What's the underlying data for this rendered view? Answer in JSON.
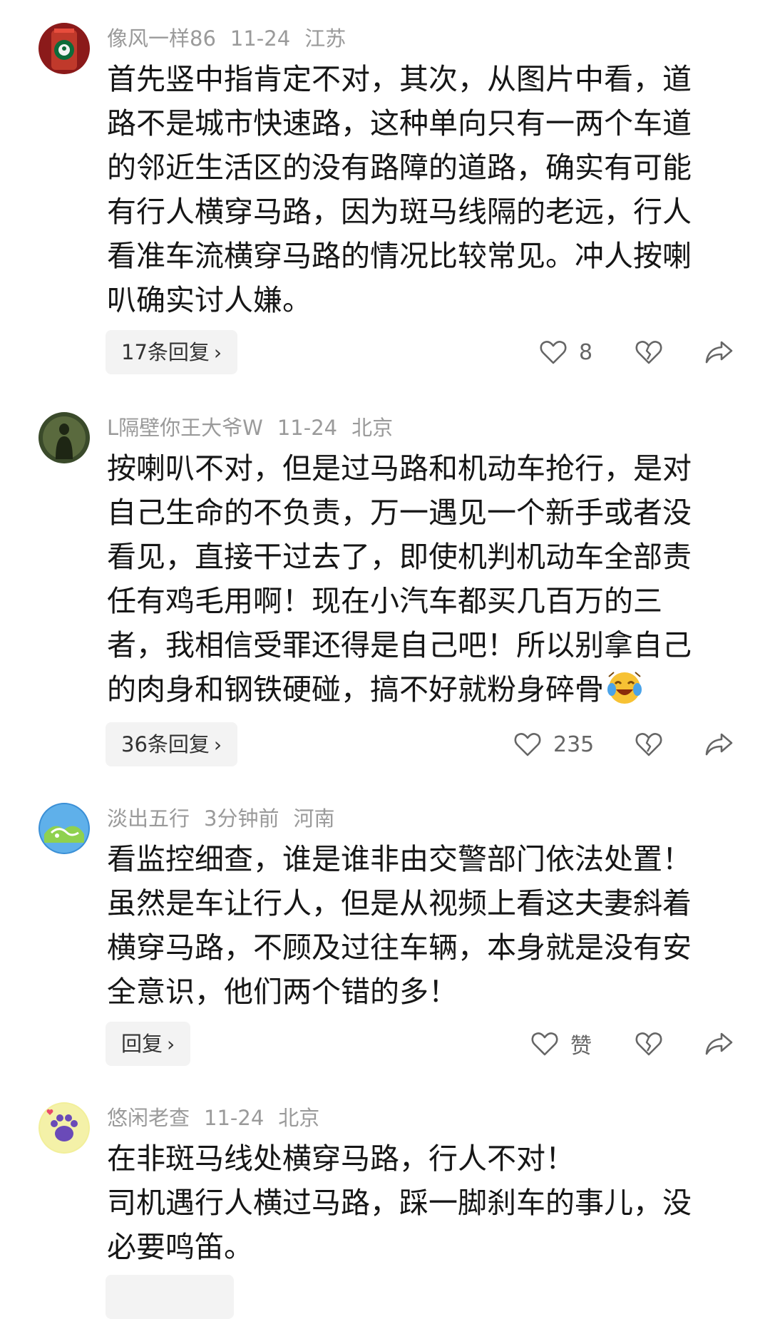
{
  "comments": [
    {
      "username": "像风一样86",
      "time": "11-24",
      "location": "江苏",
      "text": "首先竖中指肯定不对，其次，从图片中看，道\n路不是城市快速路，这种单向只有一两个车道\n的邻近生活区的没有路障的道路，确实有可能\n有行人横穿马路，因为斑马线隔的老远，行人\n看准车流横穿马路的情况比较常见。冲人按喇\n叭确实讨人嫌。",
      "reply_label": "17条回复",
      "likes": "8",
      "avatar_icon": "starbucks-cup-avatar"
    },
    {
      "username": "L隔壁你王大爷W",
      "time": "11-24",
      "location": "北京",
      "text": "按喇叭不对，但是过马路和机动车抢行，是对\n自己生命的不负责，万一遇见一个新手或者没\n看见，直接干过去了，即使机判机动车全部责\n任有鸡毛用啊！现在小汽车都买几百万的三\n者，我相信受罪还得是自己吧！所以别拿自己\n的肉身和钢铁硬碰，搞不好就粉身碎骨",
      "reply_label": "36条回复",
      "likes": "235",
      "avatar_icon": "silhouette-avatar",
      "emoji": "laughing-crying-emoji"
    },
    {
      "username": "淡出五行",
      "time": "3分钟前",
      "location": "河南",
      "text": "看监控细查，谁是谁非由交警部门依法处置！\n虽然是车让行人，但是从视频上看这夫妻斜着\n横穿马路，不顾及过往车辆，本身就是没有安\n全意识，他们两个错的多！",
      "reply_label": "回复",
      "likes": "赞",
      "avatar_icon": "handshake-avatar"
    },
    {
      "username": "悠闲老查",
      "time": "11-24",
      "location": "北京",
      "text": "在非斑马线处横穿马路，行人不对！\n司机遇行人横过马路，踩一脚刹车的事儿，没\n必要鸣笛。",
      "avatar_icon": "paw-avatar"
    }
  ],
  "reply_chevron": "›",
  "colors": {
    "meta": "#9a9a9a",
    "text": "#161616",
    "reply_bg": "#f3f3f3",
    "icon": "#666666"
  }
}
